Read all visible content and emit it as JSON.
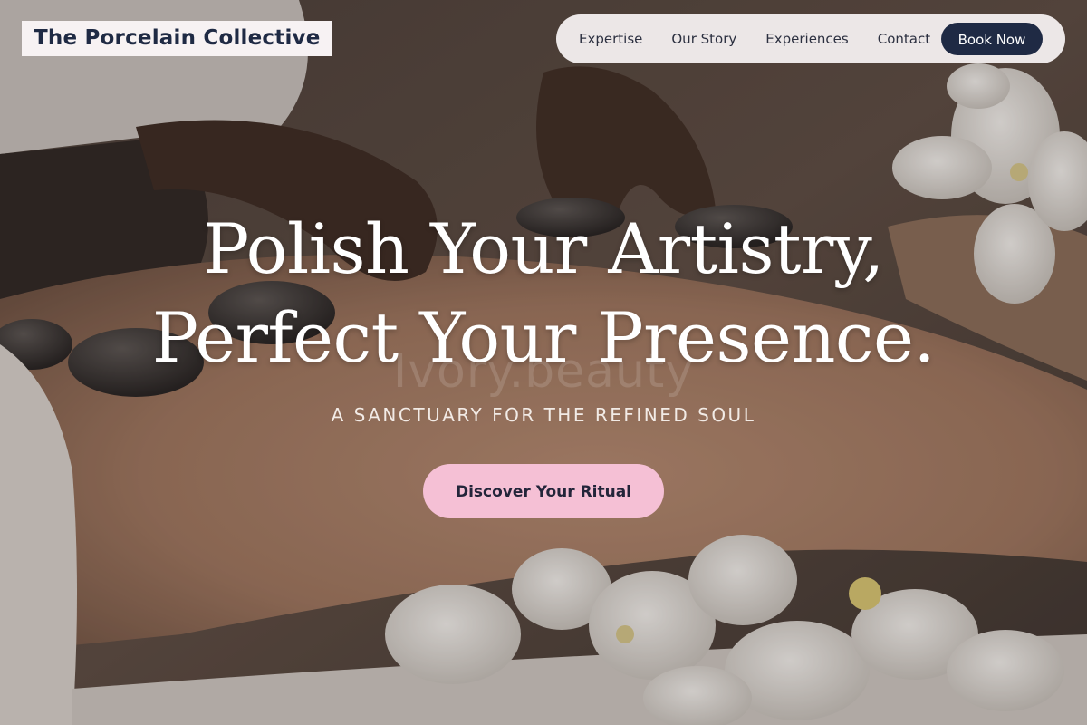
{
  "brand": {
    "name": "The Porcelain Collective"
  },
  "nav": {
    "links": [
      "Expertise",
      "Our Story",
      "Experiences",
      "Contact"
    ],
    "book_label": "Book Now"
  },
  "hero": {
    "headline_line1": "Polish Your Artistry,",
    "headline_line2": "Perfect Your Presence.",
    "watermark": "Ivory.beauty",
    "subtitle": "A SANCTUARY FOR THE REFINED SOUL",
    "cta_label": "Discover Your Ritual"
  },
  "colors": {
    "brand_navy": "#1f2a44",
    "cta_pink": "#f5c0d5",
    "nav_background": "#f4f0f0"
  }
}
